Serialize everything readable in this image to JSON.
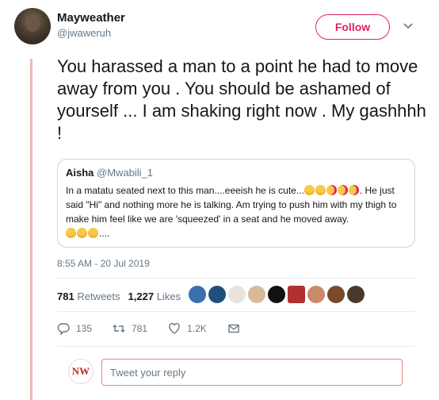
{
  "tweet": {
    "author_name": "Mayweather",
    "author_handle": "@jwaweruh",
    "follow_label": "Follow",
    "text": "You harassed a man to a point he had to move away from you . You should be ashamed of yourself ... I am shaking right now . My gashhhh !",
    "timestamp": "8:55 AM - 20 Jul 2019"
  },
  "quote": {
    "name": "Aisha",
    "handle": "@Mwabili_1",
    "text_part1": "In a matatu seated next to this man....eeeish he is cute...",
    "text_part2": ". He just said \"Hi\" and nothing more he is talking. Am trying to push him with my thigh to make him feel like we are 'squeezed' in a seat and he moved away.",
    "text_part3": "...."
  },
  "stats": {
    "retweets_count": "781",
    "retweets_label": "Retweets",
    "likes_count": "1,227",
    "likes_label": "Likes"
  },
  "actions": {
    "replies": "135",
    "retweets": "781",
    "likes": "1.2K"
  },
  "reply": {
    "placeholder": "Tweet your reply",
    "avatar_initials": "NW"
  },
  "colors": {
    "accent": "#e0245e",
    "thread_line": "#f0b7b7",
    "secondary_text": "#657786"
  }
}
